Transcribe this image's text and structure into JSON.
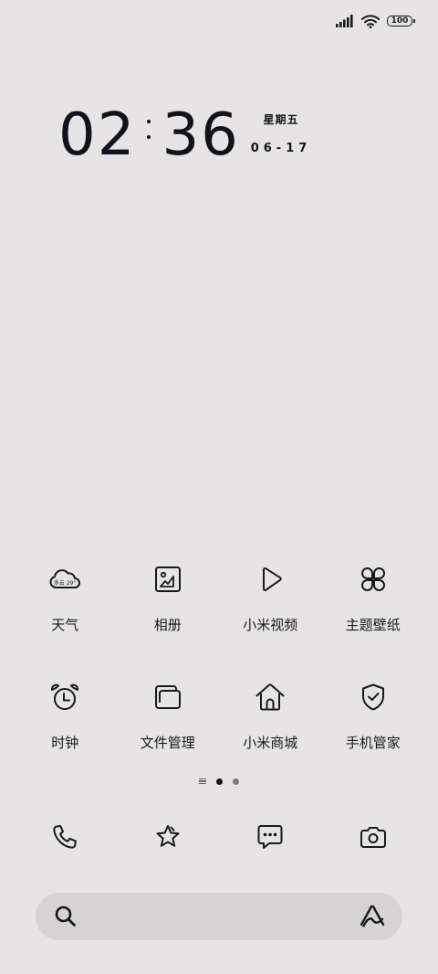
{
  "status_bar": {
    "battery_level": "100"
  },
  "clock": {
    "hours": "02",
    "minutes": "36",
    "weekday": "星期五",
    "date": "06-17"
  },
  "weather_widget": {
    "text": "多云 29°"
  },
  "apps": [
    {
      "label": "天气",
      "icon": "weather-cloud-icon"
    },
    {
      "label": "相册",
      "icon": "gallery-icon"
    },
    {
      "label": "小米视频",
      "icon": "play-icon"
    },
    {
      "label": "主题壁纸",
      "icon": "clover-icon"
    },
    {
      "label": "时钟",
      "icon": "alarm-clock-icon"
    },
    {
      "label": "文件管理",
      "icon": "folder-icon"
    },
    {
      "label": "小米商城",
      "icon": "home-icon"
    },
    {
      "label": "手机管家",
      "icon": "shield-check-icon"
    }
  ],
  "page_indicator": {
    "pages": 2,
    "active_index": 0
  },
  "dock": [
    {
      "icon": "phone-icon"
    },
    {
      "icon": "star-icon"
    },
    {
      "icon": "message-icon"
    },
    {
      "icon": "camera-icon"
    }
  ],
  "search_bar": {
    "left_icon": "search-icon",
    "right_icon": "assistant-icon"
  }
}
